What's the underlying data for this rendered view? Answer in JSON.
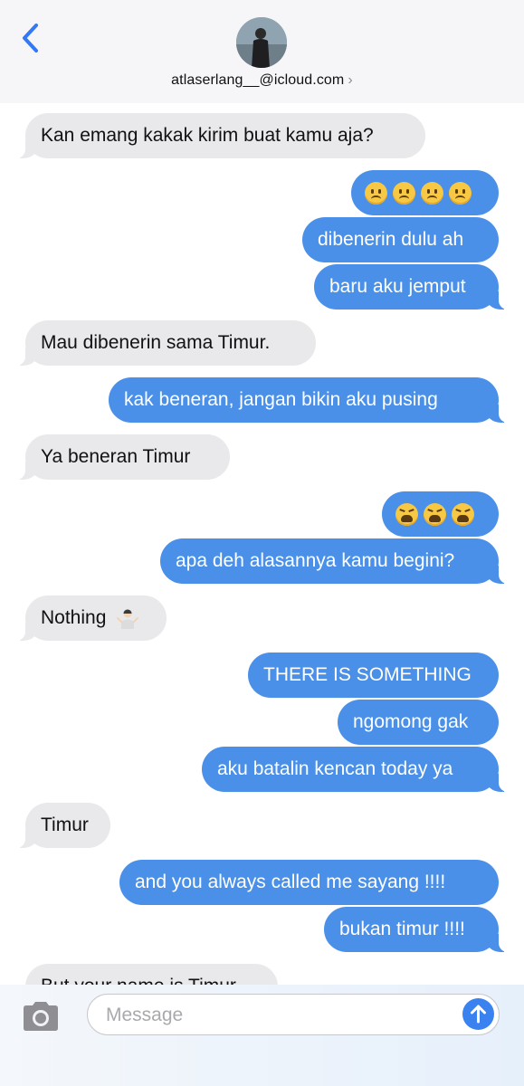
{
  "header": {
    "back_icon": "chevron-left-icon",
    "contact": "atlaserlang__@icloud.com",
    "contact_chevron": "›",
    "accent": "#3478f6"
  },
  "messages": [
    {
      "side": "in",
      "text": "Kan emang kakak kirim buat kamu aja?"
    },
    {
      "side": "out",
      "text": "",
      "emoji": "slightly-frowning-face x4"
    },
    {
      "side": "out",
      "text": "dibenerin dulu ah"
    },
    {
      "side": "out",
      "text": "baru aku jemput"
    },
    {
      "side": "in",
      "text": "Mau dibenerin sama Timur."
    },
    {
      "side": "out",
      "text": "kak beneran, jangan bikin aku pusing"
    },
    {
      "side": "in",
      "text": "Ya beneran Timur"
    },
    {
      "side": "out",
      "text": "",
      "emoji": "weary-face x3"
    },
    {
      "side": "out",
      "text": "apa deh alasannya kamu begini?"
    },
    {
      "side": "in",
      "text": "Nothing",
      "emoji": "person-shrugging"
    },
    {
      "side": "out",
      "text": "THERE IS SOMETHING"
    },
    {
      "side": "out",
      "text": "ngomong gak"
    },
    {
      "side": "out",
      "text": "aku batalin kencan today ya"
    },
    {
      "side": "in",
      "text": "Timur"
    },
    {
      "side": "out",
      "text": "and you always called me sayang !!!!"
    },
    {
      "side": "out",
      "text": "bukan timur !!!!"
    },
    {
      "side": "in",
      "text": "But your name is Timur"
    }
  ],
  "input": {
    "camera_icon": "camera-icon",
    "placeholder": "Message",
    "send_icon": "arrow-up-icon"
  },
  "colors": {
    "incoming_bubble": "#e9e9eb",
    "outgoing_bubble": "#4a90e8",
    "header_bg": "#f6f6f8"
  }
}
